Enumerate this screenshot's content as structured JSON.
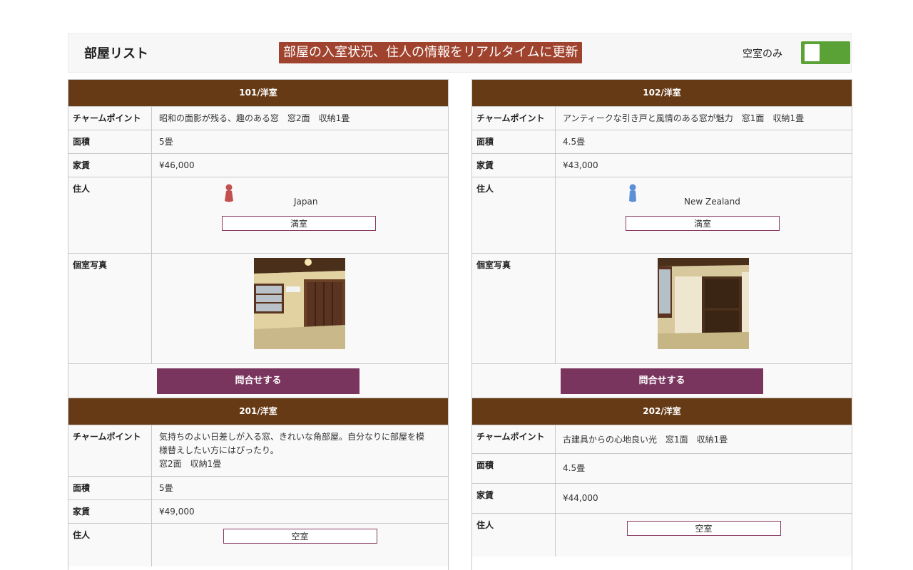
{
  "header": {
    "title": "部屋リスト",
    "banner": "部屋の入室状況、住人の情報をリアルタイムに更新",
    "filter_label": "空室のみ"
  },
  "colors": {
    "card_header": "#663a14",
    "banner": "#a0432e",
    "cta": "#7a355e",
    "toggle": "#5aa136",
    "resident_female": "#c2504e",
    "resident_male": "#5b8fd6"
  },
  "labels": {
    "charm": "チャームポイント",
    "area": "面積",
    "rent": "家賃",
    "resident": "住人",
    "photo": "個室写真",
    "contact": "問合せする"
  },
  "rooms": [
    {
      "title": "101/洋室",
      "charm": "昭和の面影が残る、趣のある窓　窓2面　収納1畳",
      "area": "5畳",
      "rent": "¥46,000",
      "resident_icon": "female-resident-icon",
      "country": "Japan",
      "status": "満室"
    },
    {
      "title": "102/洋室",
      "charm": "アンティークな引き戸と風情のある窓が魅力　窓1面　収納1畳",
      "area": "4.5畳",
      "rent": "¥43,000",
      "resident_icon": "male-resident-icon",
      "country": "New Zealand",
      "status": "満室"
    },
    {
      "title": "201/洋室",
      "charm1": "気持ちのよい日差しが入る窓、きれいな角部屋。自分なりに部屋を模",
      "charm2": "様替えしたい方にはぴったり。",
      "charm3": "窓2面　収納1畳",
      "area": "5畳",
      "rent": "¥49,000",
      "status": "空室"
    },
    {
      "title": "202/洋室",
      "charm": "古建具からの心地良い光　窓1面　収納1畳",
      "area": "4.5畳",
      "rent": "¥44,000",
      "status": "空室"
    }
  ]
}
